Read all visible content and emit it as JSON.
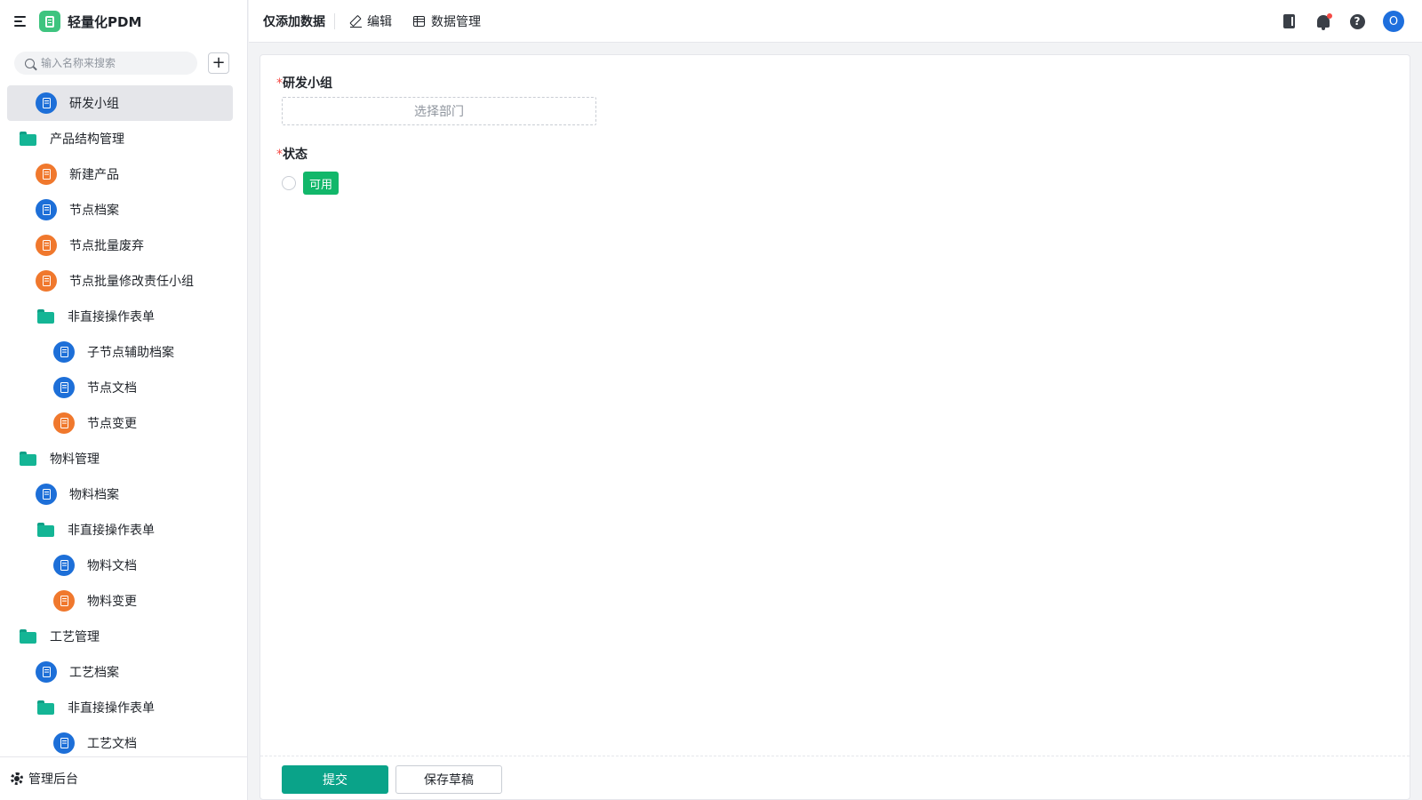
{
  "app": {
    "title": "轻量化PDM"
  },
  "search": {
    "placeholder": "输入名称来搜索"
  },
  "add_label": "+",
  "sidebar": {
    "items": [
      {
        "label": "研发小组",
        "icon": "page-icon",
        "color": "blue",
        "selected": true
      },
      {
        "label": "产品结构管理",
        "icon": "folder-icon"
      },
      {
        "label": "新建产品",
        "icon": "page-icon",
        "color": "orange"
      },
      {
        "label": "节点档案",
        "icon": "page-icon",
        "color": "blue"
      },
      {
        "label": "节点批量废弃",
        "icon": "page-icon",
        "color": "orange"
      },
      {
        "label": "节点批量修改责任小组",
        "icon": "page-icon",
        "color": "orange"
      },
      {
        "label": "非直接操作表单",
        "icon": "folder-icon"
      },
      {
        "label": "子节点辅助档案",
        "icon": "page-icon",
        "color": "blue"
      },
      {
        "label": "节点文档",
        "icon": "page-icon",
        "color": "blue"
      },
      {
        "label": "节点变更",
        "icon": "page-icon",
        "color": "orange"
      },
      {
        "label": "物料管理",
        "icon": "folder-icon"
      },
      {
        "label": "物料档案",
        "icon": "page-icon",
        "color": "blue"
      },
      {
        "label": "非直接操作表单",
        "icon": "folder-icon"
      },
      {
        "label": "物料文档",
        "icon": "page-icon",
        "color": "blue"
      },
      {
        "label": "物料变更",
        "icon": "page-icon",
        "color": "orange"
      },
      {
        "label": "工艺管理",
        "icon": "folder-icon"
      },
      {
        "label": "工艺档案",
        "icon": "page-icon",
        "color": "blue"
      },
      {
        "label": "非直接操作表单",
        "icon": "folder-icon"
      },
      {
        "label": "工艺文档",
        "icon": "page-icon",
        "color": "blue"
      }
    ],
    "footer_label": "管理后台"
  },
  "topbar": {
    "title": "仅添加数据",
    "edit_label": "编辑",
    "data_manage_label": "数据管理",
    "avatar_letter": "O"
  },
  "form": {
    "required_mark": "*",
    "group_label": "研发小组",
    "group_placeholder": "选择部门",
    "status_label": "状态",
    "status_option": "可用"
  },
  "footer": {
    "submit_label": "提交",
    "draft_label": "保存草稿"
  },
  "colors": {
    "accent": "#0aa389",
    "status_green": "#12b76a",
    "blue_icon": "#1d6fd8",
    "orange_icon": "#f0782d",
    "folder": "#14b595"
  }
}
